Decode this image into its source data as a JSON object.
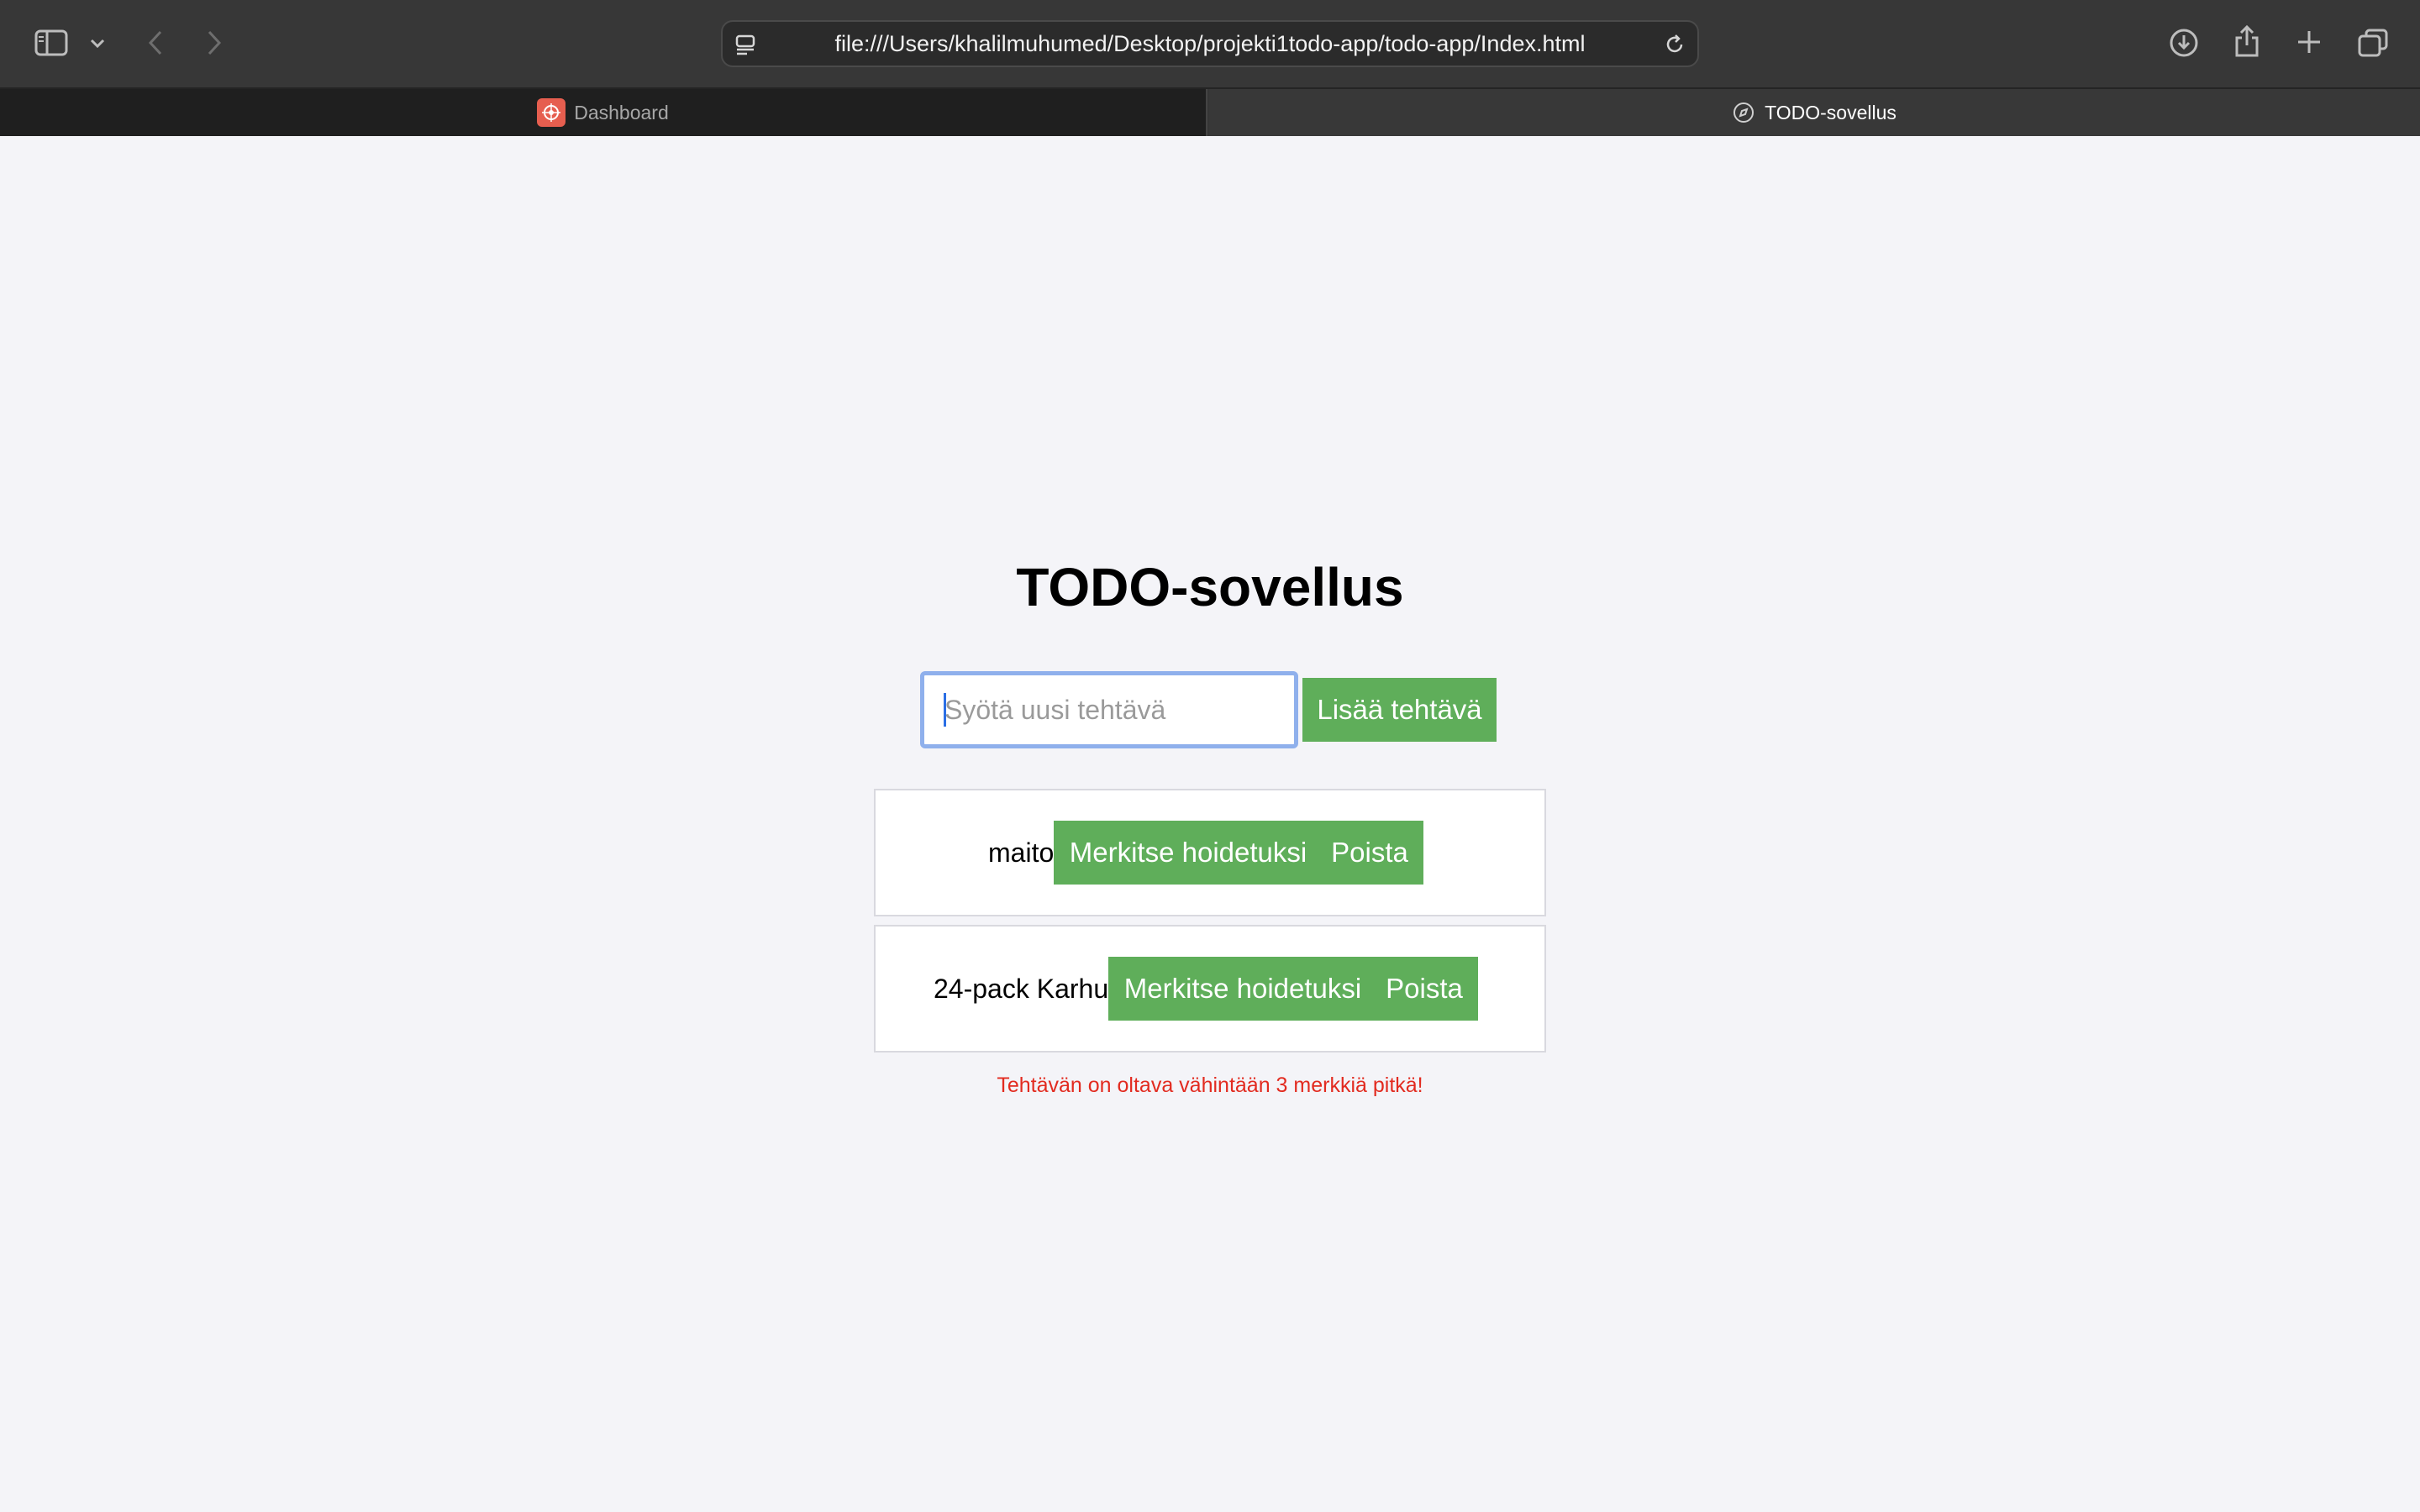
{
  "browser": {
    "url": "file:///Users/khalilmuhumed/Desktop/projekti1todo-app/todo-app/Index.html",
    "tabs": [
      {
        "label": "Dashboard",
        "active": false
      },
      {
        "label": "TODO-sovellus",
        "active": true
      }
    ],
    "icons": [
      "sidebar-icon",
      "chevron-down-icon",
      "back-icon",
      "forward-icon",
      "page-menu-icon",
      "reload-icon",
      "download-icon",
      "share-icon",
      "new-tab-icon",
      "tab-overview-icon"
    ]
  },
  "app": {
    "title": "TODO-sovellus",
    "input": {
      "value": "",
      "placeholder": "Syötä uusi tehtävä"
    },
    "add_button": "Lisää tehtävä",
    "todos": [
      {
        "text": "maito",
        "complete_label": "Merkitse hoidetuksi",
        "delete_label": "Poista"
      },
      {
        "text": "24-pack Karhu",
        "complete_label": "Merkitse hoidetuksi",
        "delete_label": "Poista"
      }
    ],
    "error": "Tehtävän on oltava vähintään 3 merkkiä pitkä!"
  },
  "colors": {
    "button_green": "#5fae5a",
    "error_red": "#e22b20",
    "focus_ring": "#8fb0ec",
    "page_bg": "#f4f4f8"
  }
}
